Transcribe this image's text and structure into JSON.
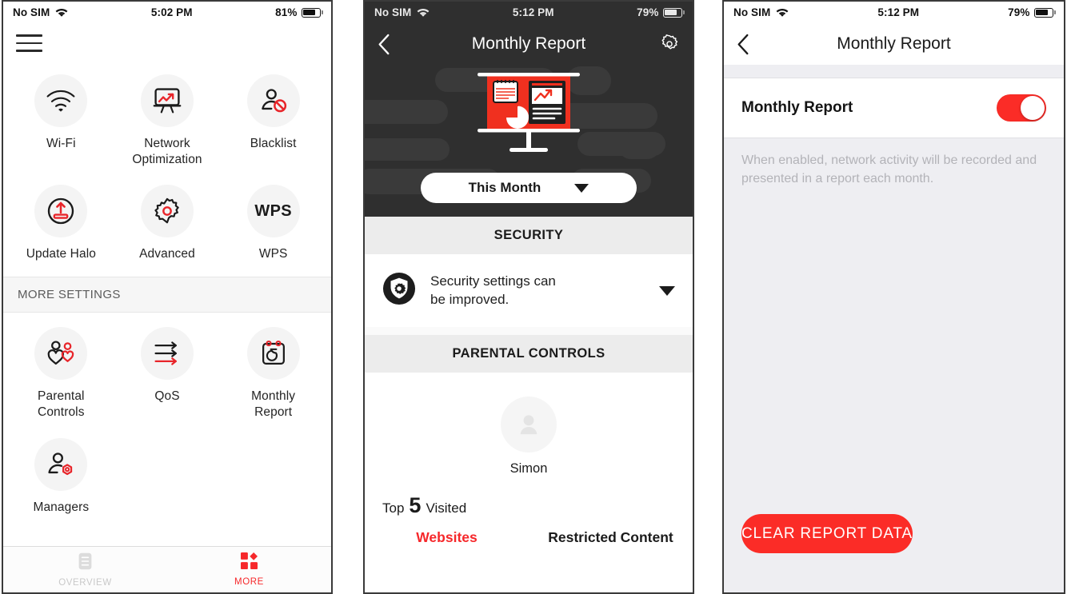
{
  "brand": {
    "red": "#fb2c27",
    "dark": "#2f2f2f",
    "gray_bg": "#eeeef2",
    "tile_bg": "#f4f4f4"
  },
  "panel_left": {
    "status": {
      "carrier": "No SIM",
      "wifi_icon": "wifi-icon",
      "time": "5:02 PM",
      "battery_pct": "81%",
      "battery_level": 81
    },
    "menu_icon": "hamburger-menu-icon",
    "tiles": [
      {
        "label": "Wi-Fi",
        "icon": "wifi-icon"
      },
      {
        "label": "Network\nOptimization",
        "label_line1": "Network",
        "label_line2": "Optimization",
        "icon": "presentation-chart-icon"
      },
      {
        "label": "Blacklist",
        "icon": "user-blocked-icon"
      },
      {
        "label": "Update Halo",
        "icon": "upload-update-icon"
      },
      {
        "label": "Advanced",
        "icon": "gear-icon"
      },
      {
        "label": "WPS",
        "icon": "wps-text-icon",
        "icon_text": "WPS"
      }
    ],
    "section_header": "MORE SETTINGS",
    "more_tiles": [
      {
        "label_line1": "Parental",
        "label_line2": "Controls",
        "icon": "parental-controls-icon"
      },
      {
        "label_line1": "QoS",
        "label_line2": "",
        "icon": "qos-arrows-icon"
      },
      {
        "label_line1": "Monthly",
        "label_line2": "Report",
        "icon": "calendar-report-icon"
      },
      {
        "label_line1": "Managers",
        "label_line2": "",
        "icon": "user-manager-icon"
      }
    ],
    "tabbar": [
      {
        "label": "OVERVIEW",
        "icon": "overview-list-icon",
        "active": false
      },
      {
        "label": "MORE",
        "icon": "grid-more-icon",
        "active": true
      }
    ]
  },
  "panel_mid": {
    "status": {
      "carrier": "No SIM",
      "wifi_icon": "wifi-icon",
      "time": "5:12 PM",
      "battery_pct": "79%",
      "battery_level": 79
    },
    "nav": {
      "back_icon": "chevron-left-icon",
      "title": "Monthly Report",
      "settings_icon": "gear-icon"
    },
    "hero": {
      "illustration": "monitor-report-illustration"
    },
    "period_dropdown": {
      "value": "This Month",
      "caret_icon": "chevron-down-icon"
    },
    "security": {
      "section_title": "SECURITY",
      "row_icon": "shield-gear-icon",
      "row_text_line1": "Security settings can",
      "row_text_line2": "be improved.",
      "expand_icon": "chevron-down-icon"
    },
    "parental": {
      "section_title": "PARENTAL CONTROLS",
      "avatar_icon": "user-avatar-icon",
      "user_name": "Simon",
      "top_prefix": "Top",
      "top_number": "5",
      "top_suffix": "Visited",
      "tabs": [
        {
          "label": "Websites",
          "active": true
        },
        {
          "label": "Restricted Content",
          "active": false
        }
      ]
    }
  },
  "panel_right": {
    "status": {
      "carrier": "No SIM",
      "wifi_icon": "wifi-icon",
      "time": "5:12 PM",
      "battery_pct": "79%",
      "battery_level": 79
    },
    "nav": {
      "back_icon": "chevron-left-icon",
      "title": "Monthly Report"
    },
    "toggle_row": {
      "label": "Monthly Report",
      "state": "on"
    },
    "description": "When enabled, network activity will be recorded and presented in a report each month.",
    "clear_button": {
      "label": "CLEAR REPORT DATA"
    }
  }
}
